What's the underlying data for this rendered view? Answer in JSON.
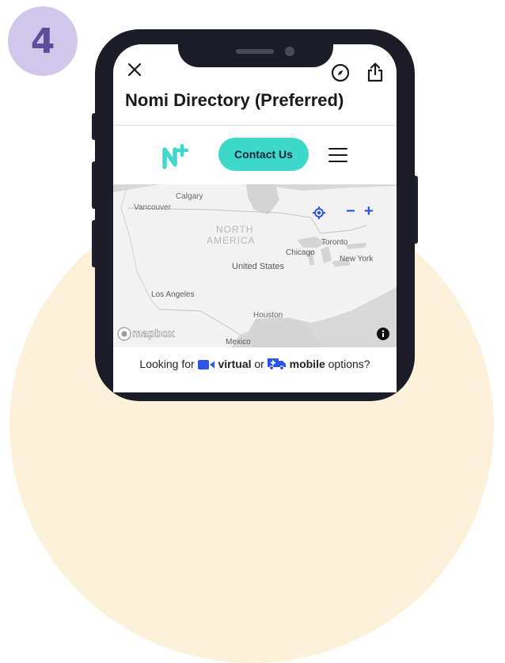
{
  "step": {
    "number": "4"
  },
  "header": {
    "title": "Nomi Directory (Preferred)"
  },
  "nav": {
    "contact_label": "Contact Us"
  },
  "map": {
    "labels": {
      "calgary": "Calgary",
      "vancouver": "Vancouver",
      "north": "NORTH",
      "america": "AMERICA",
      "toronto": "Toronto",
      "chicago": "Chicago",
      "new_york": "New York",
      "united_states": "United States",
      "los_angeles": "Los Angeles",
      "houston": "Houston",
      "mexico": "Mexico"
    },
    "attribution": "mapbox",
    "zoom_out_label": "−",
    "zoom_in_label": "+"
  },
  "footer": {
    "prefix": "Looking for",
    "virtual": "virtual",
    "or": "or",
    "mobile": "mobile",
    "suffix": "options?"
  },
  "colors": {
    "accent": "#3fd9cc",
    "step_badge": "#cfc8ea",
    "step_text": "#5d4d9c",
    "map_control": "#2a55e5"
  }
}
